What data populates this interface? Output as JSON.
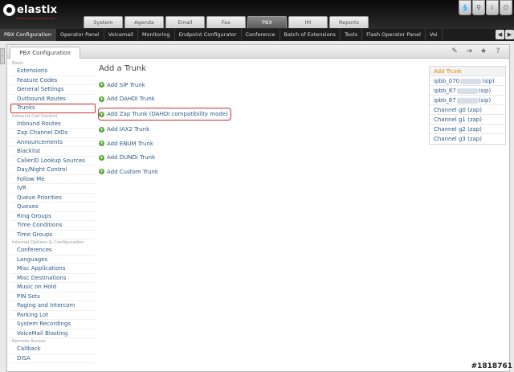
{
  "logo": {
    "text": "elastix",
    "tagline": "FREEDOM TO COMMUNICATE"
  },
  "top_tabs": [
    {
      "label": "System",
      "active": false
    },
    {
      "label": "Agenda",
      "active": false
    },
    {
      "label": "Email",
      "active": false
    },
    {
      "label": "Fax",
      "active": false
    },
    {
      "label": "PBX",
      "active": true
    },
    {
      "label": "IM",
      "active": false
    },
    {
      "label": "Reports",
      "active": false
    }
  ],
  "top_icons": [
    "droplet-icon",
    "search-icon",
    "info-icon",
    "power-icon"
  ],
  "submenu": [
    {
      "label": "PBX Configuration",
      "active": true
    },
    {
      "label": "Operator Panel",
      "active": false
    },
    {
      "label": "Voicemail",
      "active": false
    },
    {
      "label": "Monitoring",
      "active": false
    },
    {
      "label": "Endpoint Configurator",
      "active": false
    },
    {
      "label": "Conference",
      "active": false
    },
    {
      "label": "Batch of Extensions",
      "active": false
    },
    {
      "label": "Tools",
      "active": false
    },
    {
      "label": "Flash Operator Panel",
      "active": false
    },
    {
      "label": "Voi",
      "active": false
    }
  ],
  "panel": {
    "tab_label": "PBX Configuration",
    "actions": [
      "edit-icon",
      "collapse-icon",
      "star-icon",
      "help-icon"
    ]
  },
  "sidebar": {
    "sections": [
      {
        "title": "Basic",
        "items": [
          {
            "label": "Extensions"
          },
          {
            "label": "Feature Codes"
          },
          {
            "label": "General Settings"
          },
          {
            "label": "Outbound Routes"
          },
          {
            "label": "Trunks",
            "highlight": true
          }
        ]
      },
      {
        "title": "Inbound Call Control",
        "items": [
          {
            "label": "Inbound Routes"
          },
          {
            "label": "Zap Channel DIDs"
          },
          {
            "label": "Announcements"
          },
          {
            "label": "Blacklist"
          },
          {
            "label": "CallerID Lookup Sources"
          },
          {
            "label": "Day/Night Control"
          },
          {
            "label": "Follow Me"
          },
          {
            "label": "IVR"
          },
          {
            "label": "Queue Priorities"
          },
          {
            "label": "Queues"
          },
          {
            "label": "Ring Groups"
          },
          {
            "label": "Time Conditions"
          },
          {
            "label": "Time Groups"
          }
        ]
      },
      {
        "title": "Internal Options & Configuration",
        "items": [
          {
            "label": "Conferences"
          },
          {
            "label": "Languages"
          },
          {
            "label": "Misc Applications"
          },
          {
            "label": "Misc Destinations"
          },
          {
            "label": "Music on Hold"
          },
          {
            "label": "PIN Sets"
          },
          {
            "label": "Paging and Intercom"
          },
          {
            "label": "Parking Lot"
          },
          {
            "label": "System Recordings"
          },
          {
            "label": "VoiceMail Blasting"
          }
        ]
      },
      {
        "title": "Remote Access",
        "items": [
          {
            "label": "Callback"
          },
          {
            "label": "DISA"
          }
        ]
      }
    ]
  },
  "main": {
    "title": "Add a Trunk",
    "links": [
      {
        "label": "Add SIP Trunk"
      },
      {
        "label": "Add DAHDI Trunk"
      },
      {
        "label": "Add Zap Trunk (DAHDI compatibility mode)",
        "highlight": true
      },
      {
        "label": "Add IAX2 Trunk"
      },
      {
        "label": "Add ENUM Trunk"
      },
      {
        "label": "Add DUNDi Trunk"
      },
      {
        "label": "Add Custom Trunk"
      }
    ]
  },
  "trunk_list": {
    "add_label": "Add Trunk",
    "items": [
      {
        "prefix": "ipbb_070",
        "suffix": "(sip)",
        "redacted": true
      },
      {
        "prefix": "ipbb_87",
        "suffix": "(sip)",
        "redacted": true
      },
      {
        "prefix": "ipbb_87",
        "suffix": "(sip)",
        "redacted": true
      },
      {
        "prefix": "Channel g0 (zap)",
        "suffix": "",
        "redacted": false
      },
      {
        "prefix": "Channel g1 (zap)",
        "suffix": "",
        "redacted": false
      },
      {
        "prefix": "Channel g2 (zap)",
        "suffix": "",
        "redacted": false
      },
      {
        "prefix": "Channel g3 (zap)",
        "suffix": "",
        "redacted": false
      }
    ]
  },
  "watermark": "#1818761",
  "colors": {
    "link": "#2a5a8a",
    "highlight": "#d03030",
    "add_trunk": "#e08a00",
    "plus": "#56a636"
  }
}
